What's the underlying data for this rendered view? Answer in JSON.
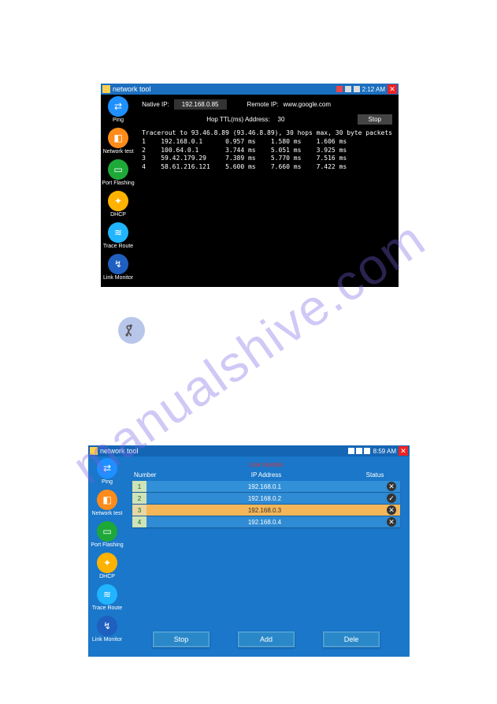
{
  "watermark": "manualshive.com",
  "app1": {
    "title": "network tool",
    "time": "2:12 AM",
    "sidebar": [
      {
        "label": "Ping",
        "color": "c-blue",
        "icon": "⇄"
      },
      {
        "label": "Network test",
        "color": "c-orange",
        "icon": "◧"
      },
      {
        "label": "Port Flashing",
        "color": "c-green",
        "icon": "▭"
      },
      {
        "label": "DHCP",
        "color": "c-yellow",
        "icon": "✦"
      },
      {
        "label": "Trace Route",
        "color": "c-sky",
        "icon": "≋"
      },
      {
        "label": "Link Monitor",
        "color": "c-dblue",
        "icon": "↯"
      }
    ],
    "labels": {
      "native_ip": "Native IP:",
      "remote_ip": "Remote IP:",
      "hop_addr": "Hop TTL(ms) Address:",
      "stop": "Stop"
    },
    "values": {
      "native_ip": "192.168.0.85",
      "remote_ip": "www.google.com",
      "hop_count": "30"
    },
    "trace_header": "Tracerout to 93.46.8.89 (93.46.8.89), 30 hops max, 30 byte packets",
    "trace_rows": [
      "1    192.168.0.1      0.957 ms    1.580 ms    1.606 ms",
      "2    100.64.0.1       3.744 ms    5.051 ms    3.925 ms",
      "3    59.42.179.29     7.389 ms    5.770 ms    7.516 ms",
      "4    58.61.216.121    5.600 ms    7.660 ms    7.422 ms"
    ]
  },
  "app2": {
    "title": "network tool",
    "time": "8:59 AM",
    "link_title": "Link monitor",
    "sidebar": [
      {
        "label": "Ping",
        "color": "c-blue",
        "icon": "⇄"
      },
      {
        "label": "Network test",
        "color": "c-orange",
        "icon": "◧"
      },
      {
        "label": "Port Flashing",
        "color": "c-green",
        "icon": "▭"
      },
      {
        "label": "DHCP",
        "color": "c-yellow",
        "icon": "✦"
      },
      {
        "label": "Trace Route",
        "color": "c-sky",
        "icon": "≋"
      },
      {
        "label": "Link Monitor",
        "color": "c-dblue",
        "icon": "↯"
      }
    ],
    "headers": {
      "num": "Number",
      "ip": "IP Address",
      "status": "Status"
    },
    "rows": [
      {
        "n": "1",
        "ip": "192.168.0.1",
        "status": "x",
        "cls": "blue1"
      },
      {
        "n": "2",
        "ip": "192.168.0.2",
        "status": "ok",
        "cls": "blue2"
      },
      {
        "n": "3",
        "ip": "192.168.0.3",
        "status": "x",
        "cls": "sel"
      },
      {
        "n": "4",
        "ip": "192.168.0.4",
        "status": "x",
        "cls": "blue2"
      }
    ],
    "buttons": {
      "stop": "Stop",
      "add": "Add",
      "dele": "Dele"
    }
  }
}
